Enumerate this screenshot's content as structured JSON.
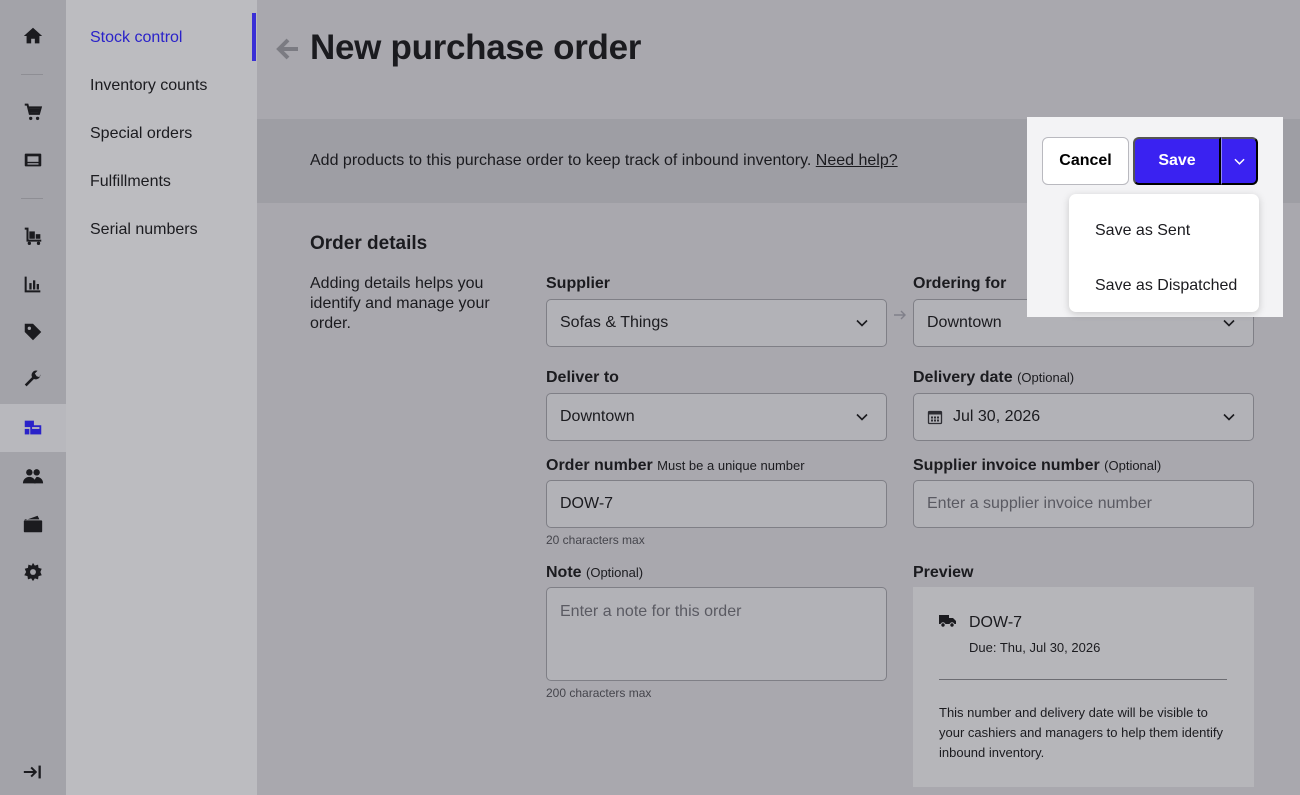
{
  "page": {
    "title": "New purchase order",
    "banner_text": "Add products to this purchase order to keep track of inbound inventory. ",
    "banner_link": "Need help?"
  },
  "subnav": {
    "items": [
      {
        "label": "Stock control",
        "active": true
      },
      {
        "label": "Inventory counts"
      },
      {
        "label": "Special orders"
      },
      {
        "label": "Fulfillments"
      },
      {
        "label": "Serial numbers"
      }
    ]
  },
  "rail": {
    "icons": [
      "home-icon",
      "cart-icon",
      "register-icon",
      "inventory-cart-icon",
      "reports-icon",
      "tag-icon",
      "wrench-icon",
      "inventory-icon",
      "customers-icon",
      "wallet-icon",
      "gear-icon",
      "collapse-icon"
    ],
    "active": "inventory-icon"
  },
  "actions": {
    "cancel": "Cancel",
    "save": "Save",
    "menu": [
      "Save as Sent",
      "Save as Dispatched"
    ]
  },
  "order_details": {
    "title": "Order details",
    "description": "Adding details helps you identify and manage your order.",
    "supplier": {
      "label": "Supplier",
      "value": "Sofas & Things"
    },
    "ordering_for": {
      "label": "Ordering for",
      "value": "Downtown"
    },
    "deliver_to": {
      "label": "Deliver to",
      "value": "Downtown"
    },
    "delivery_date": {
      "label": "Delivery date",
      "optional": "(Optional)",
      "value": "Jul 30, 2026"
    },
    "order_number": {
      "label": "Order number",
      "note": "Must be a unique number",
      "value": "DOW-7",
      "hint": "20 characters max"
    },
    "supplier_invoice": {
      "label": "Supplier invoice number",
      "optional": "(Optional)",
      "placeholder": "Enter a supplier invoice number"
    },
    "note": {
      "label": "Note",
      "optional": "(Optional)",
      "placeholder": "Enter a note for this order",
      "hint": "200 characters max"
    }
  },
  "preview": {
    "label": "Preview",
    "order": "DOW-7",
    "due": "Due: Thu, Jul 30, 2026",
    "note": "This number and delivery date will be visible to your cashiers and managers to help them identify inbound inventory."
  },
  "colors": {
    "accent": "#3a22f1",
    "nav_active": "#2a22c9"
  }
}
